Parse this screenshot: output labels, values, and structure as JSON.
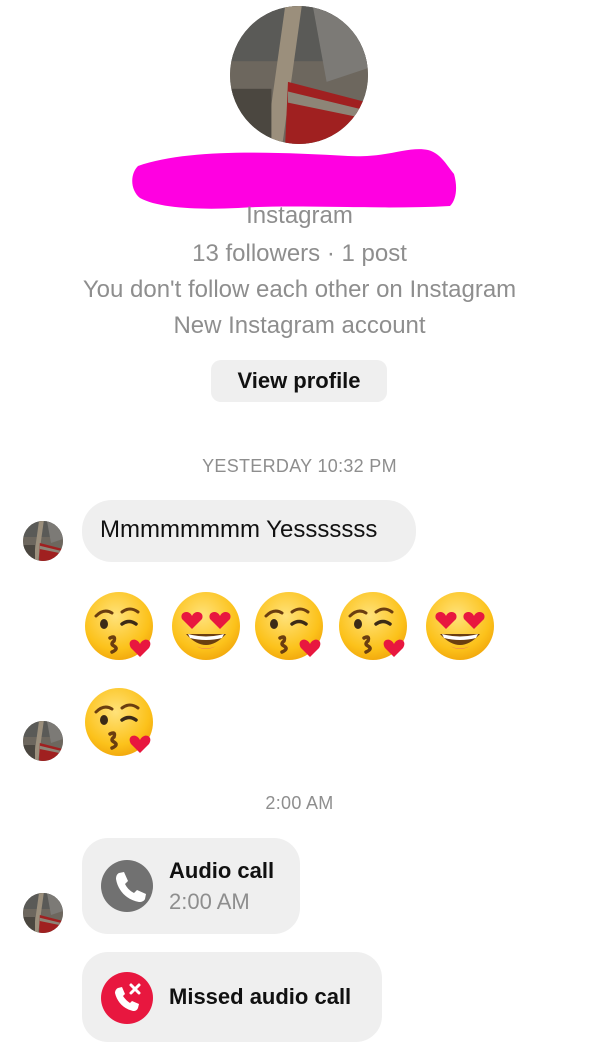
{
  "profile": {
    "app": "Instagram",
    "stats": "13 followers · 1 post",
    "follow_status": "You don't follow each other on Instagram",
    "account_note": "New Instagram account",
    "view_profile_label": "View profile",
    "redaction_color": "#ff00e1"
  },
  "thread": {
    "timestamp_1": "YESTERDAY 10:32 PM",
    "message_1": "Mmmmmmmm Yesssssss",
    "emoji_row": [
      "face-blowing-kiss",
      "smiling-face-with-heart-eyes",
      "face-blowing-kiss",
      "face-blowing-kiss",
      "smiling-face-with-heart-eyes"
    ],
    "emoji_single": "face-blowing-kiss",
    "timestamp_2": "2:00 AM",
    "call_1": {
      "title": "Audio call",
      "time": "2:00 AM",
      "icon": "phone-icon"
    },
    "call_2": {
      "title": "Missed audio call",
      "icon": "missed-call-icon"
    }
  },
  "colors": {
    "bubble": "#efefef",
    "secondary_text": "#8e8e8e",
    "missed_call": "#e8173f"
  }
}
